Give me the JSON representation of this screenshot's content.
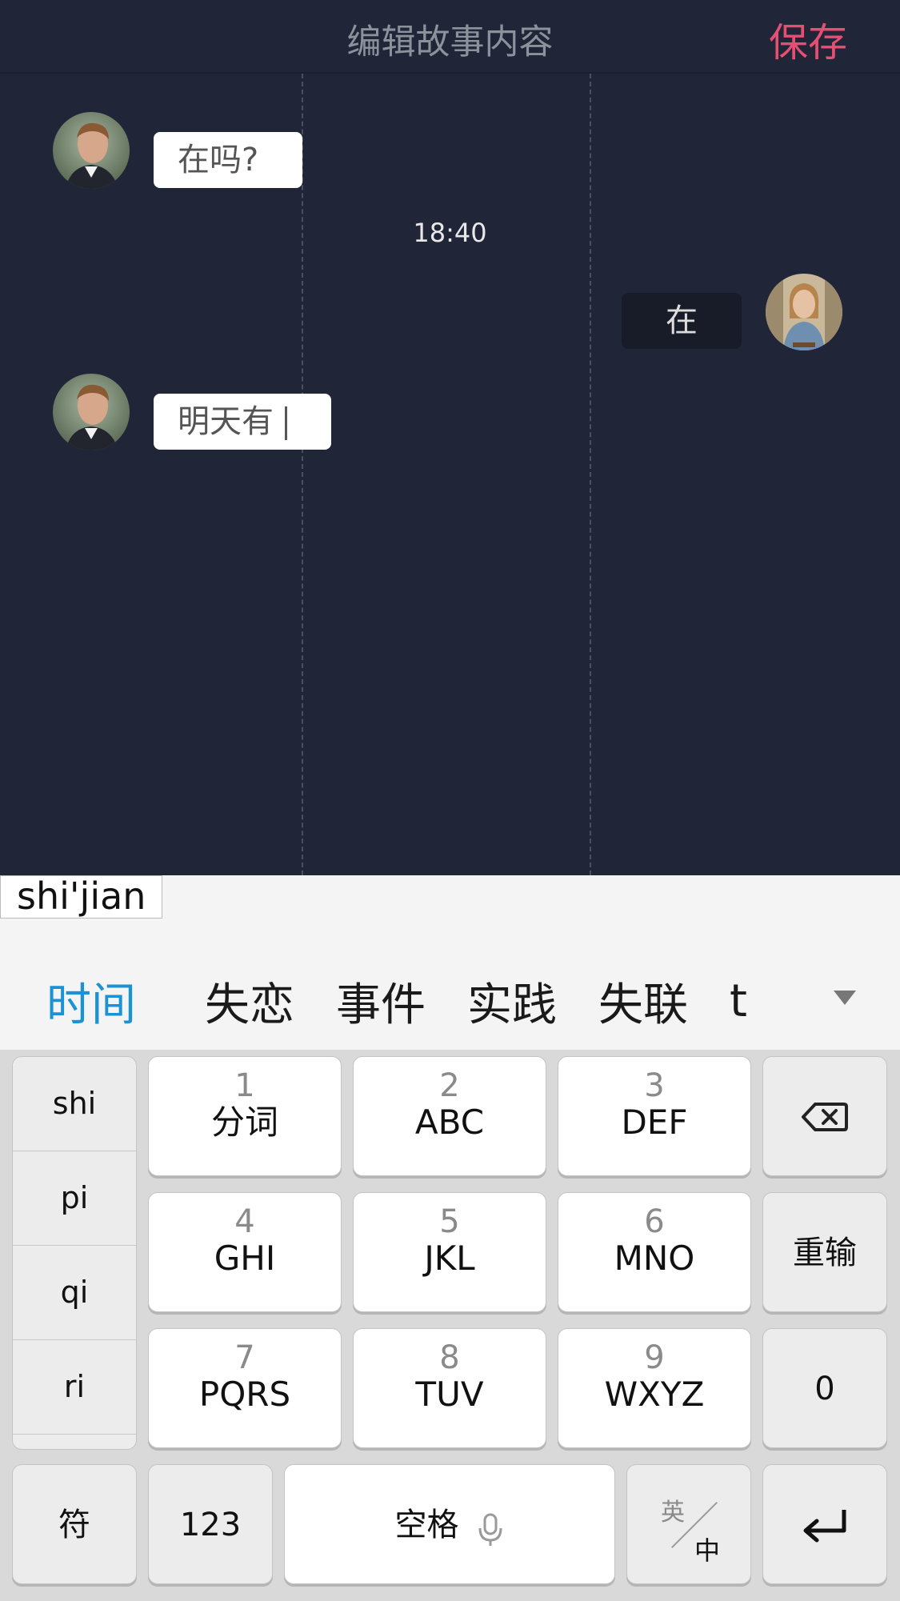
{
  "header": {
    "title": "编辑故事内容",
    "save_label": "保存"
  },
  "chat": {
    "messages": [
      {
        "side": "left",
        "text": "在吗?"
      },
      {
        "side": "right",
        "text": "在"
      },
      {
        "side": "left",
        "text": "明天有"
      }
    ],
    "timestamp": "18:40"
  },
  "ime": {
    "composition": "shi'jian",
    "candidates": [
      "时间",
      "失恋",
      "事件",
      "实践",
      "失联",
      "t"
    ],
    "pinyin_options": [
      "shi",
      "pi",
      "qi",
      "ri"
    ],
    "keys": [
      {
        "num": "1",
        "letters": "分词"
      },
      {
        "num": "2",
        "letters": "ABC"
      },
      {
        "num": "3",
        "letters": "DEF"
      },
      {
        "num": "4",
        "letters": "GHI"
      },
      {
        "num": "5",
        "letters": "JKL"
      },
      {
        "num": "6",
        "letters": "MNO"
      },
      {
        "num": "7",
        "letters": "PQRS"
      },
      {
        "num": "8",
        "letters": "TUV"
      },
      {
        "num": "9",
        "letters": "WXYZ"
      }
    ],
    "reenter_label": "重输",
    "zero_label": "0",
    "symbol_label": "符",
    "numeric_label": "123",
    "space_label": "空格",
    "lang_toggle": {
      "top": "英",
      "bottom": "中"
    },
    "icons": {
      "backspace": "backspace-icon",
      "enter": "enter-icon",
      "mic": "microphone-icon",
      "dropdown": "chevron-down-icon"
    },
    "colors": {
      "candidate_highlight": "#1a92d6",
      "save": "#e64f73"
    }
  }
}
